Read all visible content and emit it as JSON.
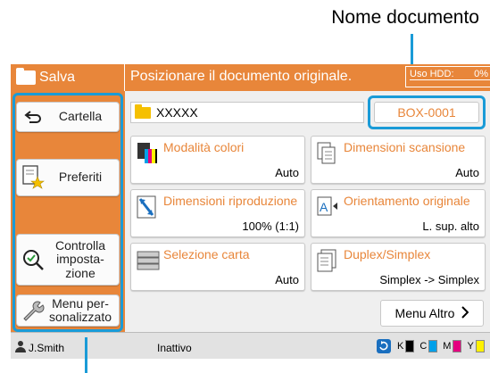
{
  "callout": {
    "doc_name_label": "Nome documento"
  },
  "titlebar": {
    "mode": "Salva",
    "message": "Posizionare il documento originale.",
    "hdd_label": "Uso HDD:",
    "hdd_value": "0%"
  },
  "sidebar": {
    "items": [
      {
        "label": "Cartella",
        "icon": "back-arrow-icon"
      },
      {
        "label": "Preferiti",
        "icon": "favorites-icon"
      },
      {
        "label": "Controlla imposta-zione",
        "icon": "magnifier-check-icon"
      },
      {
        "label": "Menu per-sonalizzato",
        "icon": "wrench-icon"
      }
    ]
  },
  "document": {
    "folder_name": "XXXXX",
    "box_label": "BOX-0001"
  },
  "tiles": [
    {
      "title": "Modalità colori",
      "value": "Auto",
      "icon": "color-mode-icon"
    },
    {
      "title": "Dimensioni scansione",
      "value": "Auto",
      "icon": "scan-size-icon"
    },
    {
      "title": "Dimensioni riproduzione",
      "value": "100% (1:1)",
      "icon": "reproduction-size-icon"
    },
    {
      "title": "Orientamento originale",
      "value": "L. sup. alto",
      "icon": "orientation-icon"
    },
    {
      "title": "Selezione carta",
      "value": "Auto",
      "icon": "paper-tray-icon"
    },
    {
      "title": "Duplex/Simplex",
      "value": "Simplex -> Simplex",
      "icon": "duplex-icon"
    }
  ],
  "more_button": {
    "label": "Menu Altro"
  },
  "statusbar": {
    "user": "J.Smith",
    "state": "Inattivo",
    "inks": [
      {
        "label": "K",
        "color": "#000000"
      },
      {
        "label": "C",
        "color": "#00a0e9"
      },
      {
        "label": "M",
        "color": "#e4007f"
      },
      {
        "label": "Y",
        "color": "#fff100"
      }
    ]
  },
  "colors": {
    "accent": "#e8863a",
    "highlight": "#1a9bd7"
  }
}
